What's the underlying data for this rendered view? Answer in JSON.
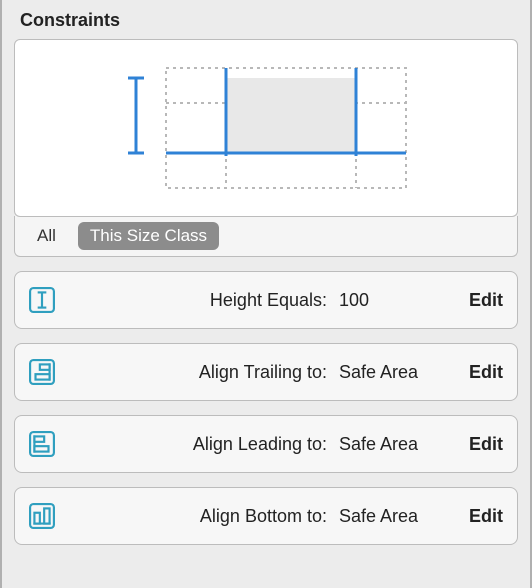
{
  "section": {
    "title": "Constraints"
  },
  "filters": {
    "all_label": "All",
    "size_class_label": "This Size Class",
    "selected": "size_class"
  },
  "edit_label": "Edit",
  "constraints": [
    {
      "icon": "height-icon",
      "label": "Height Equals:",
      "value": "100"
    },
    {
      "icon": "align-trailing-icon",
      "label": "Align Trailing to:",
      "value": "Safe Area"
    },
    {
      "icon": "align-leading-icon",
      "label": "Align Leading to:",
      "value": "Safe Area"
    },
    {
      "icon": "align-bottom-icon",
      "label": "Align Bottom to:",
      "value": "Safe Area"
    }
  ],
  "colors": {
    "accent": "#2f82d6",
    "icon_stroke": "#2f9fbf"
  }
}
